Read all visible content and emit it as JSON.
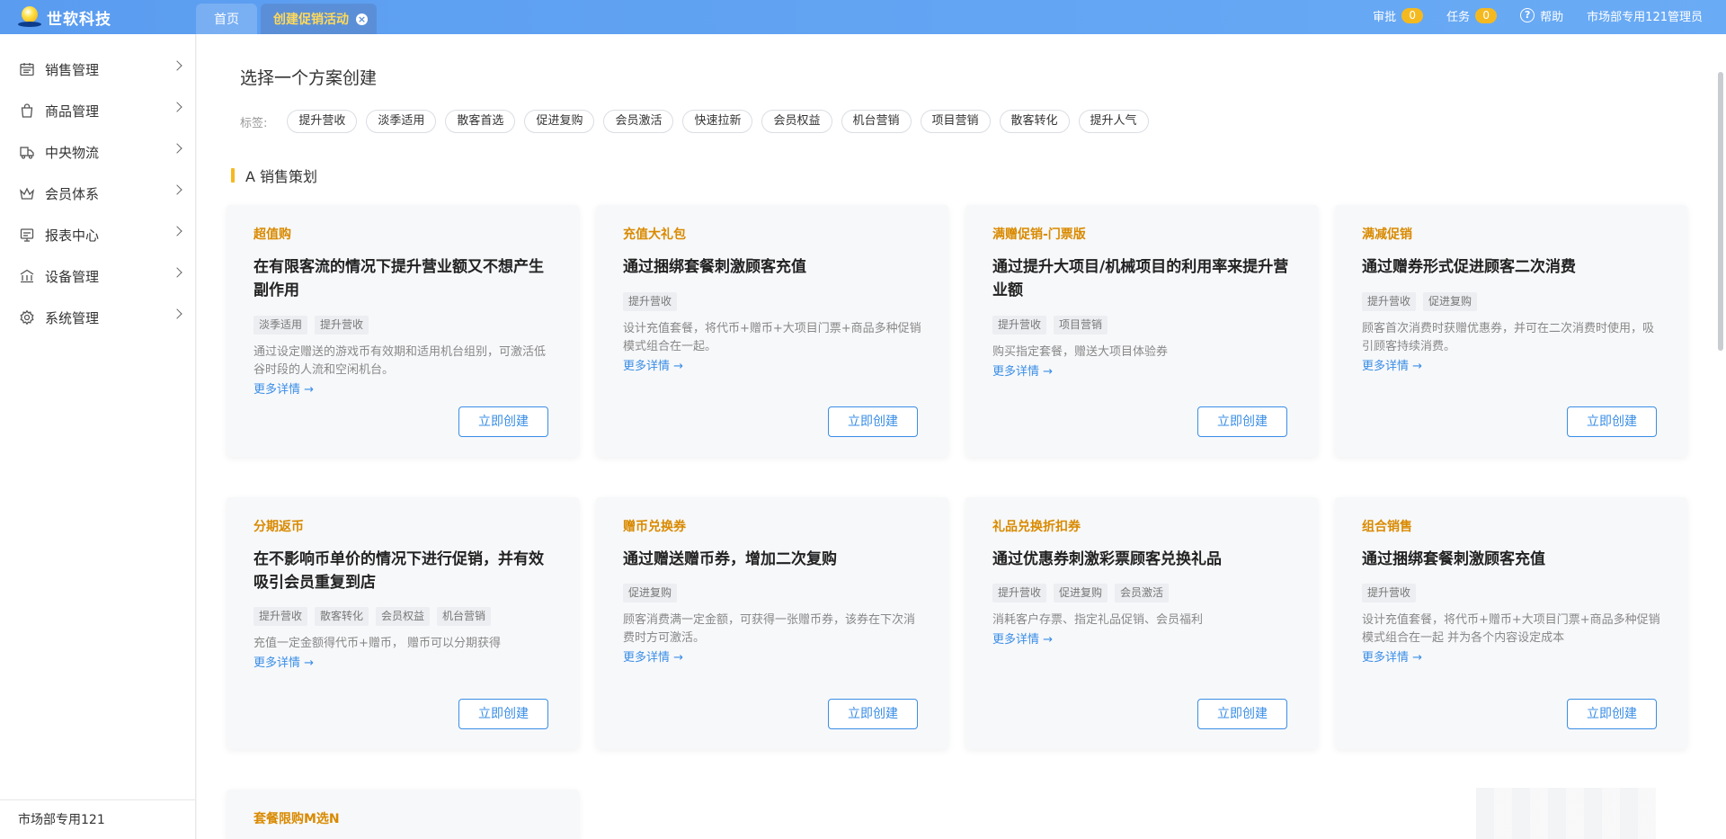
{
  "brand": {
    "name": "世软科技"
  },
  "tabs": [
    {
      "label": "首页"
    },
    {
      "label": "创建促销活动",
      "close": "×"
    }
  ],
  "topbar": {
    "approval_label": "审批",
    "approval_count": "0",
    "task_label": "任务",
    "task_count": "0",
    "help_label": "帮助",
    "help_icon": "?",
    "user": "市场部专用121管理员"
  },
  "sidebar": {
    "items": [
      {
        "label": "销售管理",
        "icon": "calendar-icon"
      },
      {
        "label": "商品管理",
        "icon": "bag-icon"
      },
      {
        "label": "中央物流",
        "icon": "truck-icon"
      },
      {
        "label": "会员体系",
        "icon": "crown-icon"
      },
      {
        "label": "报表中心",
        "icon": "report-icon"
      },
      {
        "label": "设备管理",
        "icon": "building-icon"
      },
      {
        "label": "系统管理",
        "icon": "gear-icon"
      }
    ],
    "footer": "市场部专用121"
  },
  "main": {
    "title": "选择一个方案创建",
    "tags_label": "标签:",
    "tags": [
      "提升营收",
      "淡季适用",
      "散客首选",
      "促进复购",
      "会员激活",
      "快速拉新",
      "会员权益",
      "机台营销",
      "项目营销",
      "散客转化",
      "提升人气"
    ],
    "section_title": "A 销售策划",
    "more_label": "更多详情 →",
    "create_label": "立即创建",
    "cards": [
      {
        "name": "超值购",
        "headline": "在有限客流的情况下提升营业额又不想产生副作用",
        "tags": [
          "淡季适用",
          "提升营收"
        ],
        "desc": "通过设定赠送的游戏币有效期和适用机台组别，可激活低谷时段的人流和空闲机台。"
      },
      {
        "name": "充值大礼包",
        "headline": "通过捆绑套餐刺激顾客充值",
        "tags": [
          "提升营收"
        ],
        "desc": "设计充值套餐，将代币+赠币+大项目门票+商品多种促销模式组合在一起。"
      },
      {
        "name": "满赠促销-门票版",
        "headline": "通过提升大项目/机械项目的利用率来提升营业额",
        "tags": [
          "提升营收",
          "项目营销"
        ],
        "desc": "购买指定套餐，赠送大项目体验券"
      },
      {
        "name": "满减促销",
        "headline": "通过赠券形式促进顾客二次消费",
        "tags": [
          "提升营收",
          "促进复购"
        ],
        "desc": "顾客首次消费时获赠优惠券，并可在二次消费时使用，吸引顾客持续消费。"
      },
      {
        "name": "分期返币",
        "headline": "在不影响币单价的情况下进行促销，并有效吸引会员重复到店",
        "tags": [
          "提升营收",
          "散客转化",
          "会员权益",
          "机台营销"
        ],
        "desc": "充值一定金额得代币+赠币， 赠币可以分期获得"
      },
      {
        "name": "赠币兑换券",
        "headline": "通过赠送赠币券，增加二次复购",
        "tags": [
          "促进复购"
        ],
        "desc": "顾客消费满一定金额，可获得一张赠币券，该券在下次消费时方可激活。"
      },
      {
        "name": "礼品兑换折扣券",
        "headline": "通过优惠券刺激彩票顾客兑换礼品",
        "tags": [
          "提升营收",
          "促进复购",
          "会员激活"
        ],
        "desc": "消耗客户存票、指定礼品促销、会员福利"
      },
      {
        "name": "组合销售",
        "headline": "通过捆绑套餐刺激顾客充值",
        "tags": [
          "提升营收"
        ],
        "desc": "设计充值套餐，将代币+赠币+大项目门票+商品多种促销模式组合在一起 并为各个内容设定成本"
      },
      {
        "name": "套餐限购M选N"
      }
    ]
  }
}
